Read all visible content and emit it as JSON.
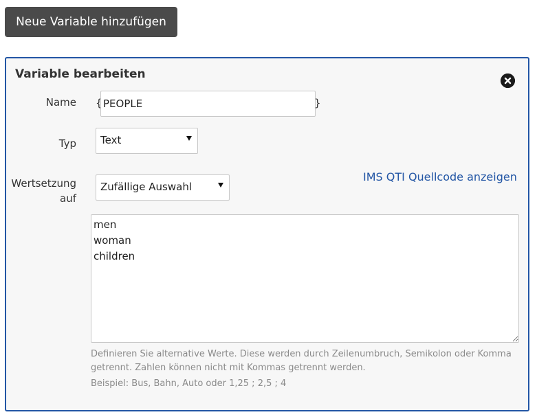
{
  "toolbar": {
    "add_variable_label": "Neue Variable hinzufügen"
  },
  "panel": {
    "title": "Variable bearbeiten",
    "close_icon": "close-circle-icon",
    "name": {
      "label": "Name",
      "brace_open": "{",
      "brace_close": "}",
      "value": "PEOPLE"
    },
    "type": {
      "label": "Typ",
      "selected": "Text"
    },
    "value_assignment": {
      "label_line1": "Wertsetzung",
      "label_line2": "auf",
      "selected": "Zufällige Auswahl"
    },
    "qti_link_label": "IMS QTI Quellcode anzeigen",
    "values_text": "men\nwoman\nchildren",
    "help_text": "Definieren Sie alternative Werte. Diese werden durch Zeilenumbruch, Semikolon oder Komma getrennt. Zahlen können nicht mit Kommas getrennt werden.",
    "example_text": "Beispiel: Bus, Bahn, Auto oder 1,25 ; 2,5 ; 4"
  },
  "colors": {
    "accent": "#2356a5",
    "button_bg": "#4a4a4a",
    "panel_bg": "#f7f7f7",
    "muted_text": "#8a8a8a"
  }
}
